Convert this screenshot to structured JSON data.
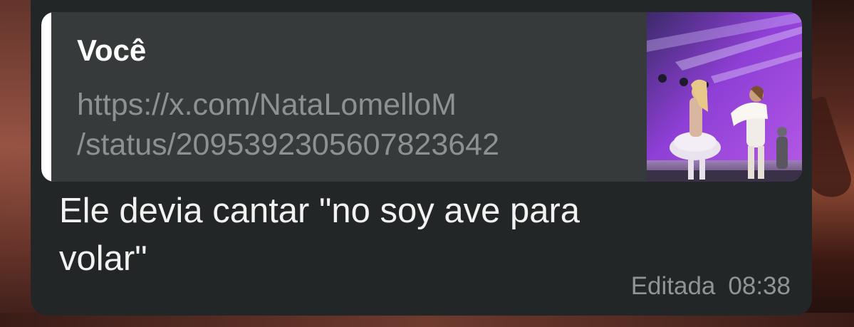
{
  "message": {
    "quote": {
      "author": "Você",
      "link_line1": "https://x.com/NataLomelloM",
      "link_line2": "/status/2095392305607823642",
      "thumbnail_icon": "concert-stage-photo"
    },
    "text_line1": "Ele devia cantar \"no soy ave para",
    "text_line2": "volar\"",
    "edited_label": "Editada",
    "time": "08:38"
  },
  "colors": {
    "bubble": "#232626",
    "quote_background": "#373a3b",
    "quote_bar": "#ffffff",
    "link_text": "#8c9193",
    "meta_text": "#8f9496"
  }
}
